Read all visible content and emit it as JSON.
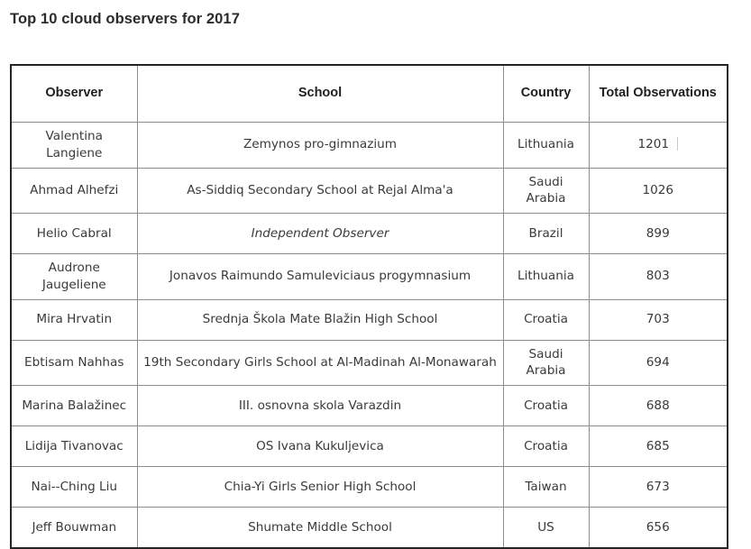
{
  "title": "Top 10 cloud observers for 2017",
  "table": {
    "columns": [
      {
        "key": "observer",
        "label": "Observer"
      },
      {
        "key": "school",
        "label": "School"
      },
      {
        "key": "country",
        "label": "Country"
      },
      {
        "key": "total",
        "label": "Total Observations"
      }
    ],
    "rows": [
      {
        "observer": "Valentina Langiene",
        "school": "Zemynos pro-gimnazium",
        "school_italic": false,
        "country": "Lithuania",
        "total": "1201",
        "has_caret": true
      },
      {
        "observer": "Ahmad Alhefzi",
        "school": "As-Siddiq Secondary School at Rejal Alma'a",
        "school_italic": false,
        "country": "Saudi Arabia",
        "total": "1026",
        "has_caret": false
      },
      {
        "observer": "Helio Cabral",
        "school": "Independent Observer",
        "school_italic": true,
        "country": "Brazil",
        "total": "899",
        "has_caret": false
      },
      {
        "observer": "Audrone Jaugeliene",
        "school": "Jonavos Raimundo Samuleviciaus progymnasium",
        "school_italic": false,
        "country": "Lithuania",
        "total": "803",
        "has_caret": false
      },
      {
        "observer": "Mira Hrvatin",
        "school": "Srednja Škola Mate Blažin High School",
        "school_italic": false,
        "country": "Croatia",
        "total": "703",
        "has_caret": false
      },
      {
        "observer": "Ebtisam Nahhas",
        "school": "19th Secondary Girls School at Al-Madinah Al-Monawarah",
        "school_italic": false,
        "country": "Saudi Arabia",
        "total": "694",
        "has_caret": false
      },
      {
        "observer": "Marina Balažinec",
        "school": "III. osnovna skola Varazdin",
        "school_italic": false,
        "country": "Croatia",
        "total": "688",
        "has_caret": false
      },
      {
        "observer": "Lidija Tivanovac",
        "school": "OS Ivana Kukuljevica",
        "school_italic": false,
        "country": "Croatia",
        "total": "685",
        "has_caret": false
      },
      {
        "observer": "Nai--Ching Liu",
        "school": "Chia-Yi Girls Senior High School",
        "school_italic": false,
        "country": "Taiwan",
        "total": "673",
        "has_caret": false
      },
      {
        "observer": "Jeff Bouwman",
        "school": "Shumate Middle School",
        "school_italic": false,
        "country": "US",
        "total": "656",
        "has_caret": false
      }
    ]
  },
  "colors": {
    "page_background": "#ffffff",
    "title_text": "#2b2b2b",
    "header_text": "#1f1f1f",
    "body_text": "#3a3a3a",
    "outer_border": "#242424",
    "inner_border": "#8c8c8c",
    "caret": "#c9c9c9"
  }
}
